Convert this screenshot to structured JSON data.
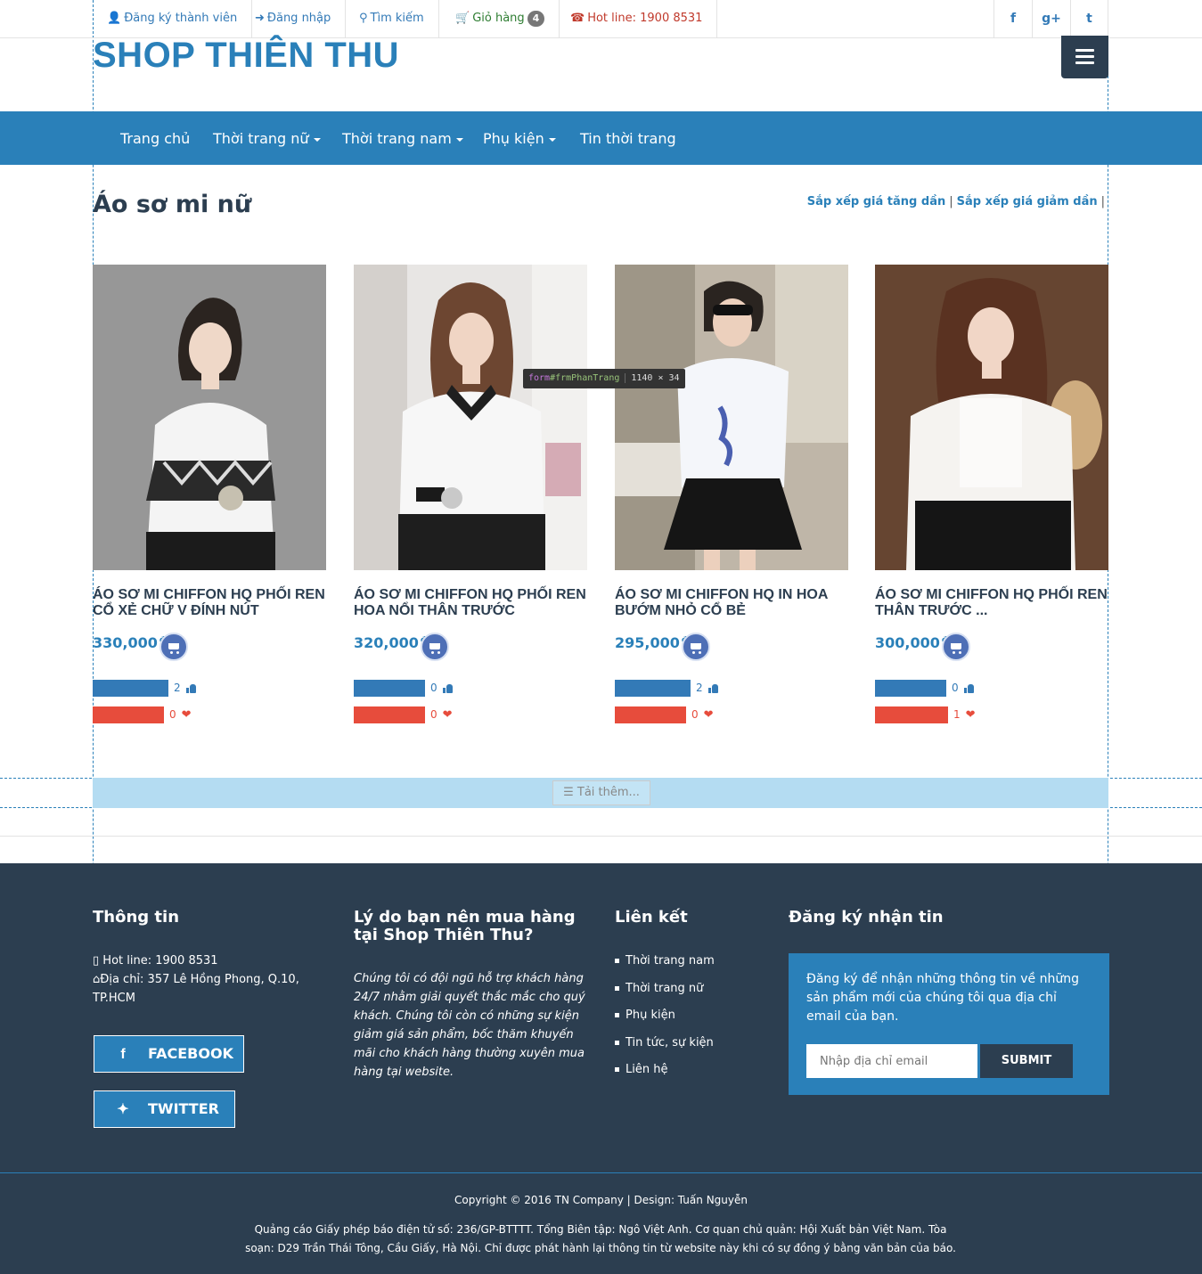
{
  "topbar": {
    "register": "Đăng ký thành viên",
    "login": "Đăng nhập",
    "search": "Tìm kiếm",
    "cart": "Giỏ hàng",
    "cart_count": "4",
    "hotline": "Hot line: 1900 8531",
    "social": [
      "f",
      "g+",
      "t"
    ]
  },
  "brand": "SHOP THIÊN THU",
  "nav": {
    "items": [
      "Trang chủ",
      "Thời trang nữ",
      "Thời trang nam",
      "Phụ kiện",
      "Tin thời trang"
    ]
  },
  "page": {
    "title": "Áo sơ mi nữ",
    "sort_asc": "Sắp xếp giá tăng dần",
    "sort_desc": "Sắp xếp giá giảm dần",
    "sep": "|"
  },
  "products": [
    {
      "name": "ÁO SƠ MI CHIFFON HQ PHỐI REN CỔ XẺ CHỮ V ĐÍNH NÚT",
      "price": "330,000",
      "currency": "đ",
      "likes": "2",
      "loves": "0",
      "like_level": 0.85,
      "love_level": 0.8
    },
    {
      "name": "ÁO SƠ MI CHIFFON HQ PHỐI REN HOA NỔI THÂN TRƯỚC",
      "price": "320,000",
      "currency": "đ",
      "likes": "0",
      "loves": "0",
      "like_level": 0.8,
      "love_level": 0.8
    },
    {
      "name": "ÁO SƠ MI CHIFFON HQ IN HOA BƯỚM NHỎ CỔ BẺ",
      "price": "295,000",
      "currency": "đ",
      "likes": "2",
      "loves": "0",
      "like_level": 0.85,
      "love_level": 0.8
    },
    {
      "name": "ÁO SƠ MI CHIFFON HQ PHỐI REN THÂN TRƯỚC ...",
      "price": "300,000",
      "currency": "đ",
      "likes": "0",
      "loves": "1",
      "like_level": 0.8,
      "love_level": 0.82
    }
  ],
  "devtools": {
    "tag": "form",
    "id": "#frmPhanTrang",
    "dims": "1140 × 34"
  },
  "loadmore": "Tải thêm...",
  "footer": {
    "info_title": "Thông tin",
    "hotline": "Hot line: 1900 8531",
    "address": "Địa chỉ: 357 Lê Hồng Phong, Q.10, TP.HCM",
    "facebook": "FACEBOOK",
    "twitter": "TWITTER",
    "why_title": "Lý do bạn nên mua hàng tại Shop Thiên Thu?",
    "why_text": "Chúng tôi có đội ngũ hỗ trợ khách hàng 24/7 nhằm giải quyết thắc mắc cho quý khách. Chúng tôi còn có những sự kiện giảm giá sản phẩm, bốc thăm khuyến mãi cho khách hàng thường xuyên mua hàng tại website.",
    "links_title": "Liên kết",
    "links": [
      "Thời trang nam",
      "Thời trang nữ",
      "Phụ kiện",
      "Tin tức, sự kiện",
      "Liên hệ"
    ],
    "sub_title": "Đăng ký nhận tin",
    "sub_text": "Đăng ký để nhận những thông tin về những sản phẩm mới của chúng tôi qua địa chỉ email của bạn.",
    "email_placeholder": "Nhập địa chỉ email",
    "submit": "SUBMIT",
    "copyright": "Copyright © 2016 TN Company | Design: Tuấn Nguyễn",
    "license": "Quảng cáo Giấy phép báo điện tử số: 236/GP-BTTTT. Tổng Biên tập: Ngô Việt Anh. Cơ quan chủ quản: Hội Xuất bản Việt Nam. Tòa soạn: D29 Trần Thái Tông, Cầu Giấy, Hà Nội. Chỉ được phát hành lại thông tin từ website này khi có sự đồng ý bằng văn bản của báo."
  },
  "colors": {
    "primary": "#2a80b9",
    "dark": "#2c3e50",
    "like": "#337ab7",
    "love": "#e74c3c"
  }
}
